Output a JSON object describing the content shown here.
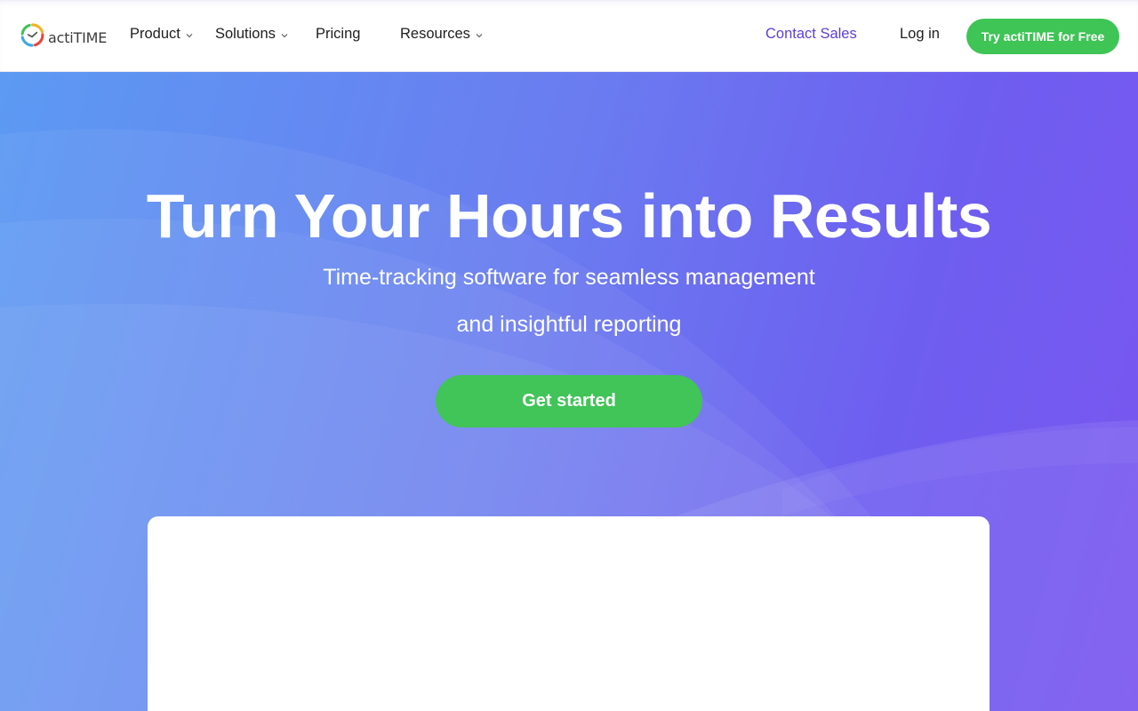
{
  "header": {
    "logo_text": "actiTIME",
    "nav": [
      {
        "label": "Product",
        "has_dropdown": true
      },
      {
        "label": "Solutions",
        "has_dropdown": true
      },
      {
        "label": "Pricing",
        "has_dropdown": false
      },
      {
        "label": "Resources",
        "has_dropdown": true
      }
    ],
    "contact_sales": "Contact Sales",
    "log_in": "Log in",
    "try_button": "Try actiTIME for Free"
  },
  "hero": {
    "title": "Turn Your Hours into Results",
    "subtitle_line1": "Time-tracking software for seamless management",
    "subtitle_line2": "and insightful reporting",
    "cta": "Get started"
  },
  "colors": {
    "brand_green": "#3fc456",
    "accent_purple": "#5b3fd9",
    "hero_gradient_start": "#5c9af3",
    "hero_gradient_end": "#7a56ef"
  },
  "icons": {
    "logo": "actitime-clock-logo-icon",
    "dropdown": "chevron-down-icon"
  }
}
